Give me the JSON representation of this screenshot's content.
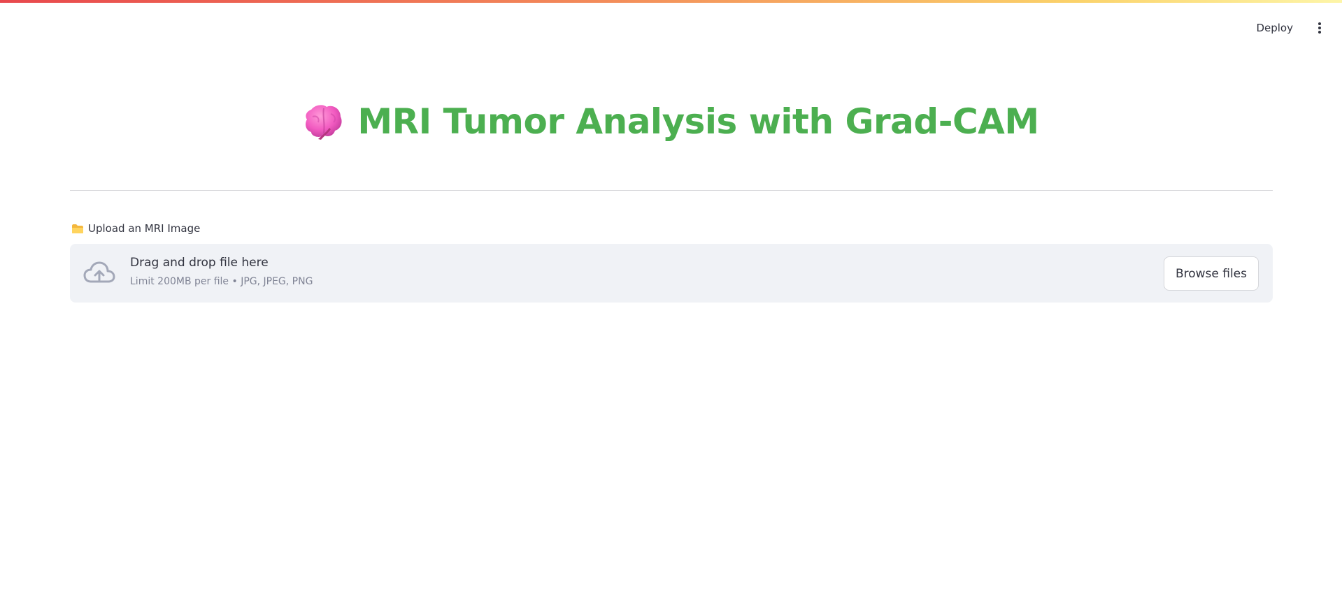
{
  "toolbar": {
    "deploy_label": "Deploy",
    "menu_icon": "kebab-menu-icon"
  },
  "header": {
    "icon": "brain-icon",
    "title": "MRI Tumor Analysis with Grad-CAM",
    "title_color": "#4caf50"
  },
  "uploader": {
    "label_icon": "folder-icon",
    "label": "Upload an MRI Image",
    "dropzone_icon": "cloud-upload-icon",
    "dropzone_title": "Drag and drop file here",
    "dropzone_limit": "Limit 200MB per file • JPG, JPEG, PNG",
    "browse_label": "Browse files"
  },
  "colors": {
    "accent_green": "#4caf50",
    "dropzone_bg": "#f0f2f6",
    "text": "#31333f",
    "muted_text": "#808495"
  }
}
